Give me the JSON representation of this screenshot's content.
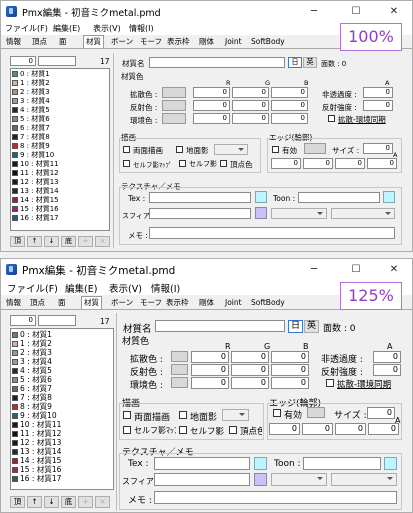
{
  "app": {
    "title": "Pmx編集 - 初音ミクmetal.pmd"
  },
  "window_controls": {
    "min": "─",
    "max": "☐",
    "close": "✕"
  },
  "menu": [
    "ファイル(F)",
    "編集(E)",
    "表示(V)",
    "情報(I)"
  ],
  "tabs": [
    "情報",
    "頂点",
    "面",
    "材質",
    "ボーン",
    "モーフ",
    "表示枠",
    "剛体",
    "Joint",
    "SoftBody"
  ],
  "zoom1": "100%",
  "zoom2": "125%",
  "list": {
    "count_left": "0",
    "count_right": "17",
    "items": [
      {
        "label": "0 : 材質1",
        "color": "#4a8a9a"
      },
      {
        "label": "1 : 材質2",
        "color": "#c8b8a8"
      },
      {
        "label": "2 : 材質3",
        "color": "#b09080"
      },
      {
        "label": "3 : 材質4",
        "color": "#9a9aa8"
      },
      {
        "label": "4 : 材質5",
        "color": "#282828"
      },
      {
        "label": "5 : 材質6",
        "color": "#8a8a8a"
      },
      {
        "label": "6 : 材質7",
        "color": "#686868"
      },
      {
        "label": "7 : 材質8",
        "color": "#202020"
      },
      {
        "label": "8 : 材質9",
        "color": "#c02828"
      },
      {
        "label": "9 : 材質10",
        "color": "#1a6a6a"
      },
      {
        "label": "10 : 材質11",
        "color": "#181818"
      },
      {
        "label": "11 : 材質12",
        "color": "#101010"
      },
      {
        "label": "12 : 材質13",
        "color": "#1a1a1a"
      },
      {
        "label": "13 : 材質14",
        "color": "#282828"
      },
      {
        "label": "14 : 材質15",
        "color": "#a02020"
      },
      {
        "label": "15 : 材質16",
        "color": "#a02858"
      },
      {
        "label": "16 : 材質17",
        "color": "#2a5a8a"
      }
    ]
  },
  "list_buttons": [
    "頂",
    "↑",
    "↓",
    "底",
    "+",
    "×"
  ],
  "material": {
    "name_label": "材質名",
    "lang_ja": "日",
    "lang_en": "英",
    "face_count": "面数 : 0",
    "color_section": "材質色",
    "rgb": [
      "R",
      "G",
      "B"
    ],
    "a": "A",
    "diffuse": "拡散色 :",
    "specular": "反射色 :",
    "ambient": "環境色 :",
    "transparency": "非透過度 :",
    "spec_strength": "反射強度 :",
    "diffuse_sync": "拡散-環境同期",
    "zero": "0",
    "draw_section": "描画",
    "double_sided": "両面描画",
    "ground_shadow": "地面影",
    "self_shadow_map": "セルフ影ﾏｯﾌﾟ",
    "self_shadow": "セルフ影",
    "vertex_color": "頂点色",
    "edge_section": "エッジ(輪郭)",
    "edge_enabled": "有効",
    "edge_size": "サイズ :",
    "texture_section": "テクスチャ／メモ",
    "tex": "Tex :",
    "toon": "Toon :",
    "sphere": "スフィア :",
    "memo": "メモ :"
  }
}
